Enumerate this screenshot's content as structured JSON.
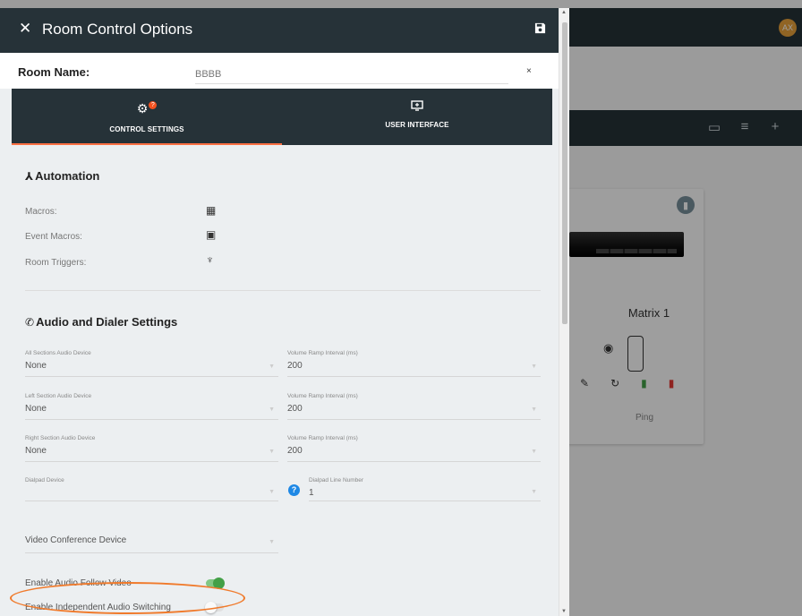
{
  "background": {
    "avatar_initials": "AX",
    "toolbar_icons": [
      "cast-icon",
      "sliders-icon",
      "plus-icon"
    ],
    "card": {
      "title": "Matrix 1",
      "ping_label": "Ping"
    }
  },
  "dialog": {
    "title": "Room Control Options",
    "room_name_label": "Room Name:",
    "room_name_value": "BBBB",
    "clear_symbol": "×",
    "tabs": [
      {
        "label": "CONTROL SETTINGS",
        "active": true
      },
      {
        "label": "USER INTERFACE",
        "active": false
      }
    ],
    "help_badge": "?",
    "automation": {
      "title": "Automation",
      "rows": [
        {
          "label": "Macros:",
          "icon": "macros-icon"
        },
        {
          "label": "Event Macros:",
          "icon": "calendar-icon"
        },
        {
          "label": "Room Triggers:",
          "icon": "trigger-icon"
        }
      ]
    },
    "audio": {
      "title": "Audio and Dialer Settings",
      "fields": {
        "all_device_label": "All Sections Audio Device",
        "all_device_value": "None",
        "all_ramp_label": "Volume Ramp Interval (ms)",
        "all_ramp_value": "200",
        "left_device_label": "Left Section Audio Device",
        "left_device_value": "None",
        "left_ramp_label": "Volume Ramp Interval (ms)",
        "left_ramp_value": "200",
        "right_device_label": "Right Section Audio Device",
        "right_device_value": "None",
        "right_ramp_label": "Volume Ramp Interval (ms)",
        "right_ramp_value": "200",
        "dialpad_device_label": "Dialpad Device",
        "dialpad_device_value": "",
        "dialpad_line_label": "Dialpad Line Number",
        "dialpad_line_value": "1"
      },
      "help_symbol": "?",
      "video_conference_label": "Video Conference Device",
      "enable_follow_label": "Enable Audio Follow Video",
      "enable_follow_on": true,
      "enable_independent_label": "Enable Independent Audio Switching",
      "enable_independent_on": false
    }
  },
  "colors": {
    "header": "#263238",
    "accent": "#ff7043",
    "toggle_on": "#43a047",
    "highlight": "#f07a2b"
  }
}
